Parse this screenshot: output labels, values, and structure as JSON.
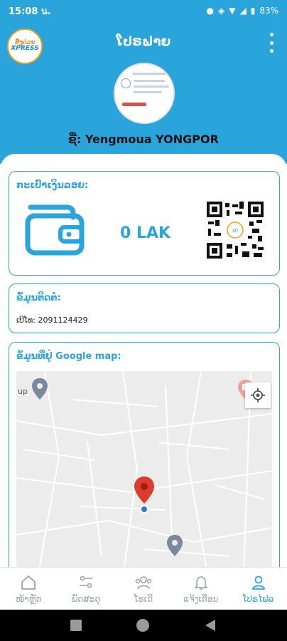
{
  "status_bar": {
    "time": "15:08 น.",
    "battery": "83%"
  },
  "header": {
    "title": "ໂປຣຟາຍ",
    "logo_text": "ສົ່ງດ່ວນ",
    "logo_word": "XPRESS"
  },
  "user": {
    "name_label": "ຊື່: Yengmoua YONGPOR"
  },
  "wallet": {
    "title": "ກະເປົາເງິນລອຍ:",
    "balance": "0 LAK"
  },
  "contact": {
    "title": "ຂໍ້ມູນຕິດຕໍ່:",
    "phone": "ເບີໂທ: 2091124429"
  },
  "map_section": {
    "title": "ຂໍ້ມູນທີ່ຢູ່ Google map:",
    "map_label": "up"
  },
  "bottom_nav": {
    "items": [
      {
        "label": "ໜ້າຫຼັກ",
        "icon": "home-icon"
      },
      {
        "label": "ພັດສະດຸ",
        "icon": "sliders-icon"
      },
      {
        "label": "ໂຮເດີ",
        "icon": "users-icon"
      },
      {
        "label": "ແຈ້ງເຕືອນ",
        "icon": "bell-icon"
      },
      {
        "label": "ໂປຣໄຟລ",
        "icon": "person-icon"
      }
    ],
    "active_index": 4
  },
  "colors": {
    "primary": "#2aa5dc",
    "map_pin": "#e03a2f",
    "location_dot": "#2f74e8"
  }
}
